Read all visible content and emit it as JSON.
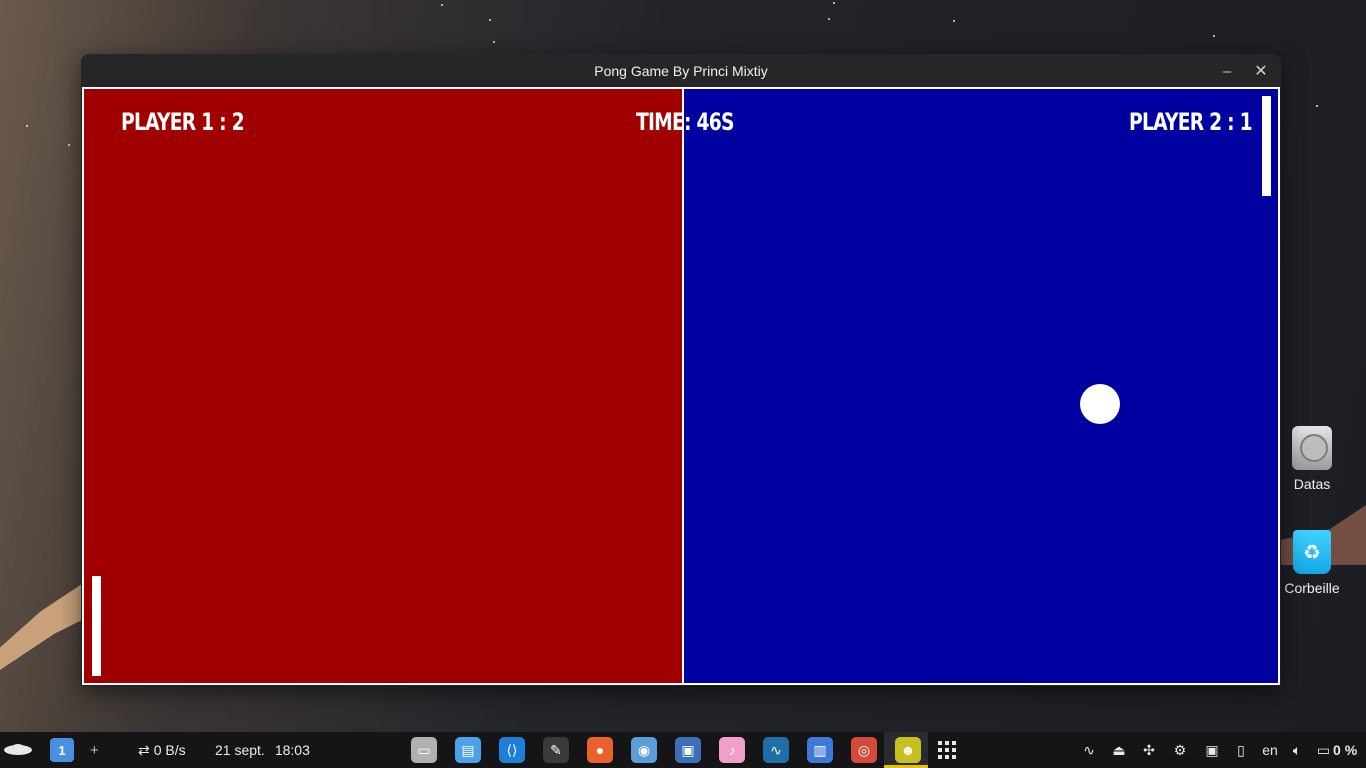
{
  "window": {
    "title": "Pong Game By Princi Mixtiy",
    "minimize_glyph": "–",
    "close_glyph": "✕"
  },
  "game": {
    "player1_score_text": "PLAYER 1 : 2",
    "player2_score_text": "PLAYER 2 : 1",
    "timer_text": "TIME: 46S",
    "left_color": "#a00000",
    "right_color": "#0000a0"
  },
  "desktop": {
    "icons": [
      {
        "label": "Datas",
        "icon": "hard-disk-icon"
      },
      {
        "label": "Corbeille",
        "icon": "trash-icon"
      }
    ]
  },
  "taskbar": {
    "workspace": "1",
    "add_workspace": "+",
    "network_speed": "0 B/s",
    "date": "21 sept.",
    "time": "18:03",
    "apps": [
      {
        "name": "terminal-icon",
        "glyph": "▭",
        "color": "#b0b0b0"
      },
      {
        "name": "file-manager-icon",
        "glyph": "▤",
        "color": "#4aa3e8"
      },
      {
        "name": "vscode-icon",
        "glyph": "⟨⟩",
        "color": "#1f7fd6"
      },
      {
        "name": "text-editor-icon",
        "glyph": "✎",
        "color": "#3a3a3a"
      },
      {
        "name": "firefox-icon",
        "glyph": "●",
        "color": "#e8622a"
      },
      {
        "name": "chromium-icon",
        "glyph": "◉",
        "color": "#5a9fd8"
      },
      {
        "name": "screenshot-tool-icon",
        "glyph": "▣",
        "color": "#3d6fb8"
      },
      {
        "name": "music-player-icon",
        "glyph": "♪",
        "color": "#f0a0c8"
      },
      {
        "name": "wave-app-icon",
        "glyph": "∿",
        "color": "#1e6fa8"
      },
      {
        "name": "package-icon",
        "glyph": "▥",
        "color": "#3f7ad8"
      },
      {
        "name": "chrome-icon",
        "glyph": "◎",
        "color": "#d44a3a"
      },
      {
        "name": "pygame-icon",
        "glyph": "☻",
        "color": "#c8c020"
      }
    ],
    "apps_grid_glyph": "⋮⋮⋮",
    "language": "en",
    "battery": "0 %"
  }
}
